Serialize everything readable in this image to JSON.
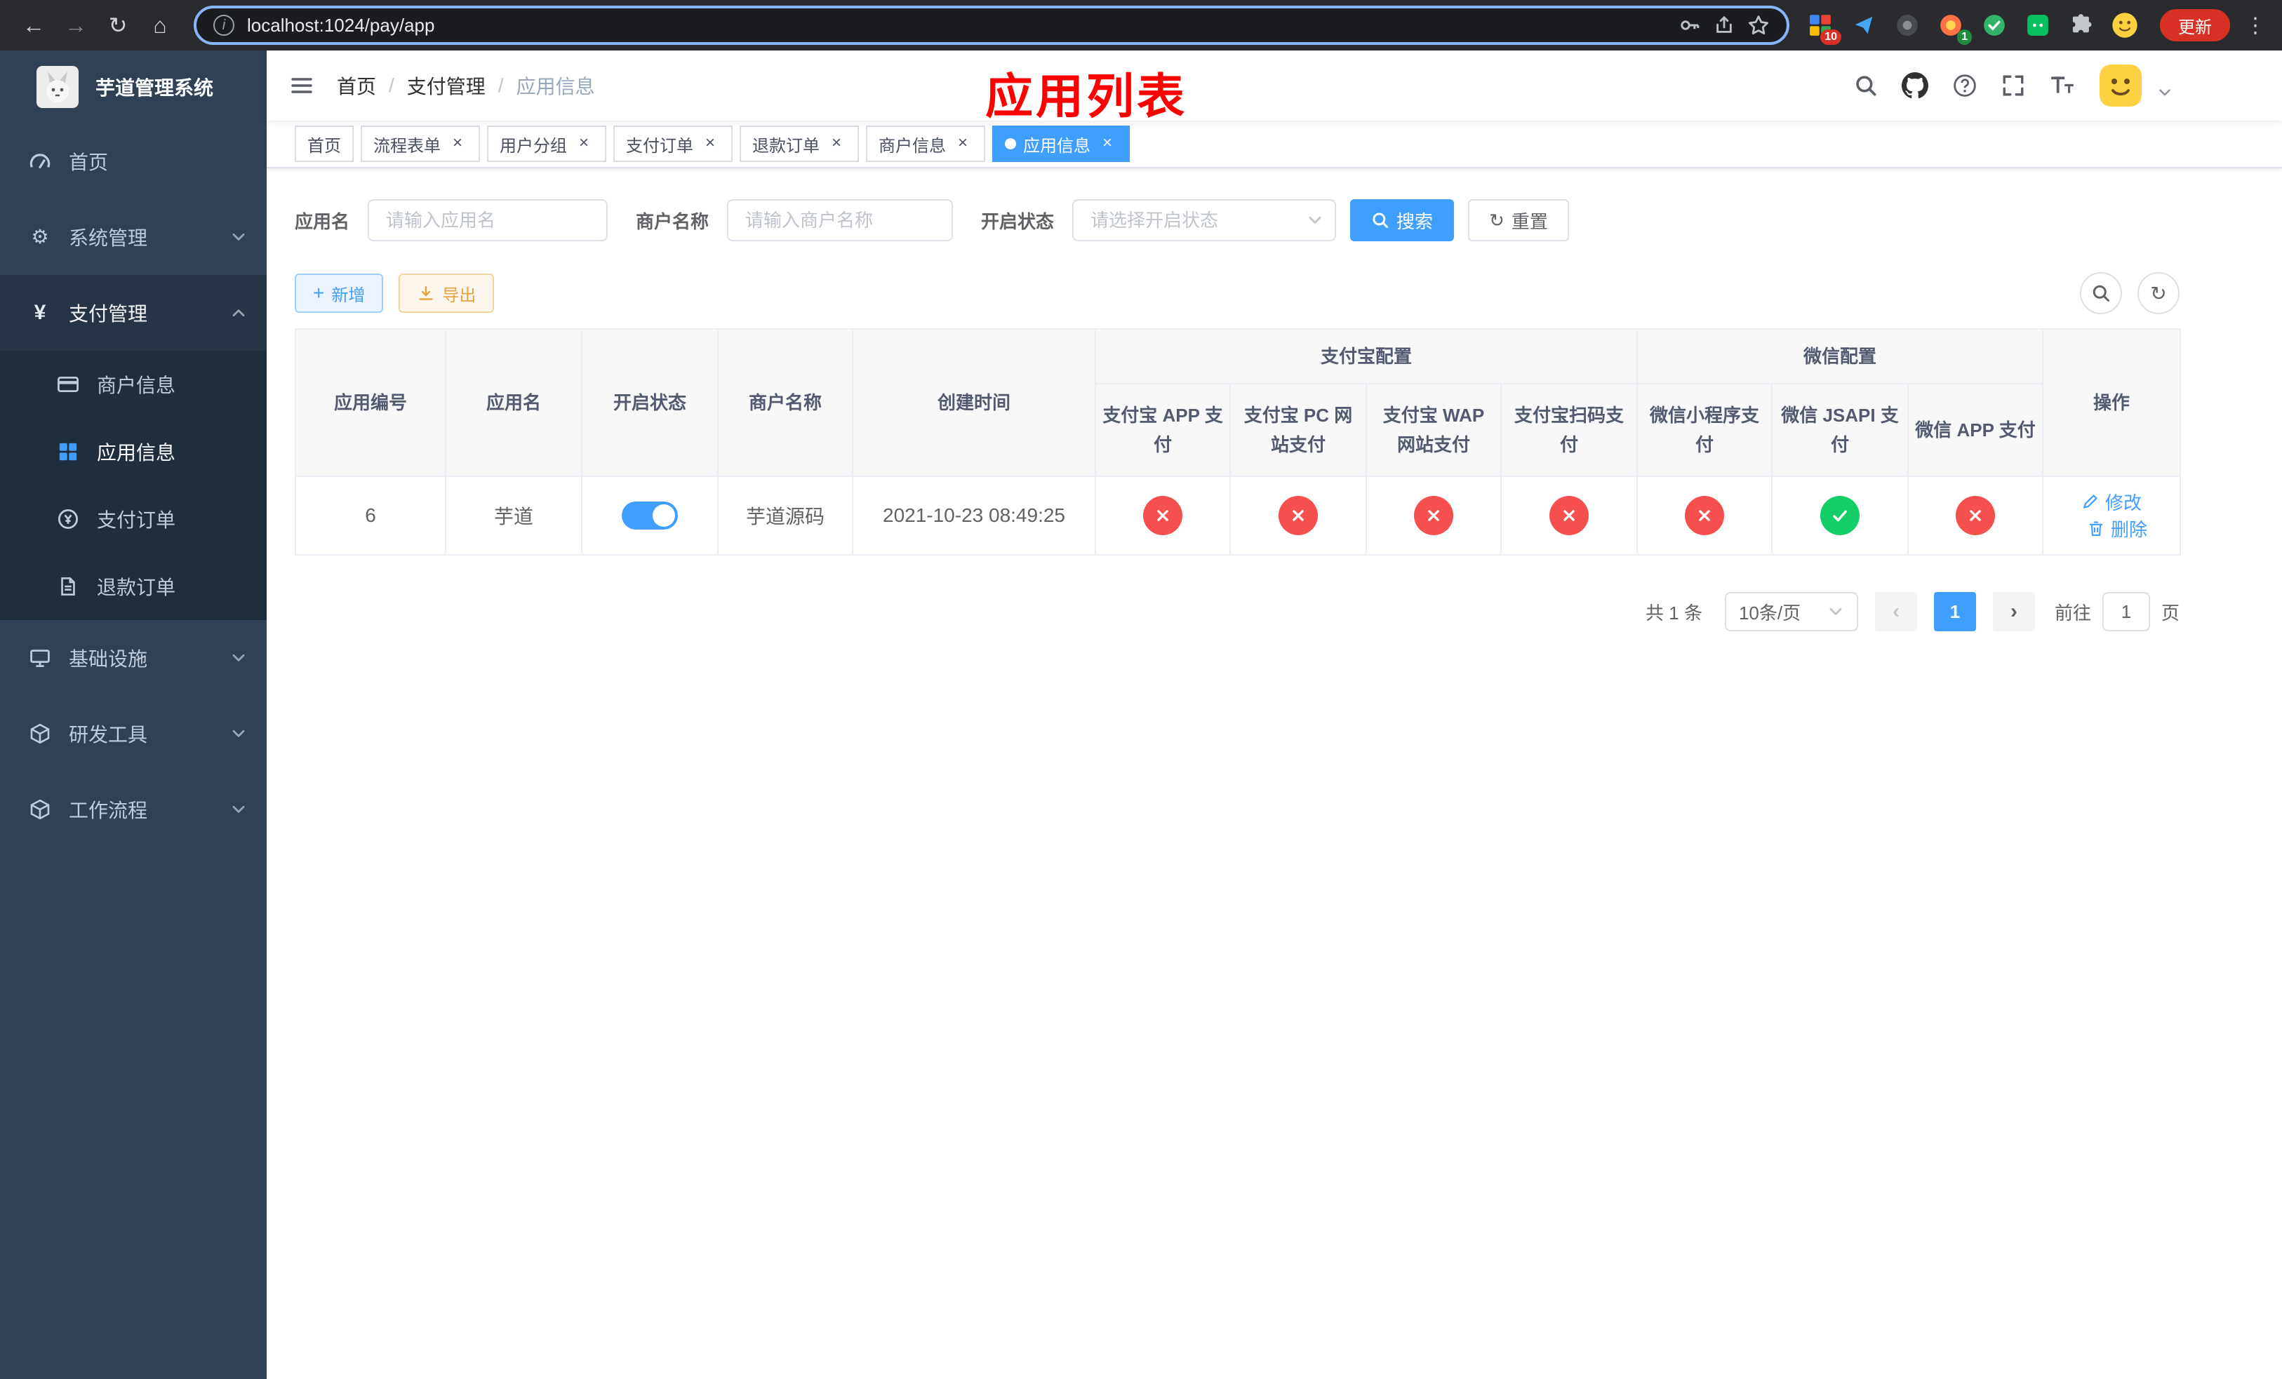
{
  "colors": {
    "accent": "#409eff",
    "success": "#13ce66",
    "danger": "#f5504d",
    "warning": "#e6a23c",
    "sidebar_bg": "#304156",
    "submenu_bg": "#1f2d3d",
    "annotation_red": "#ff0000"
  },
  "icons": {
    "back": "←",
    "forward": "→",
    "reload": "↻",
    "home": "⌂",
    "info": "i",
    "menu_dots": "⋮",
    "close": "×",
    "plus": "+",
    "page_prev": "‹",
    "page_next": "›",
    "yen": "¥",
    "gear": "⚙",
    "breadcrumb_separator": "/"
  },
  "browser": {
    "url": "localhost:1024/pay/app",
    "update_button_label": "更新",
    "extension_badge_red": "10",
    "extension_badge_green": "1"
  },
  "sidebar": {
    "app_title": "芋道管理系统",
    "items": [
      {
        "label": "首页"
      },
      {
        "label": "系统管理"
      },
      {
        "label": "支付管理"
      },
      {
        "label": "基础设施"
      },
      {
        "label": "研发工具"
      },
      {
        "label": "工作流程"
      }
    ],
    "payment_submenu": [
      {
        "label": "商户信息"
      },
      {
        "label": "应用信息"
      },
      {
        "label": "支付订单"
      },
      {
        "label": "退款订单"
      }
    ]
  },
  "navbar": {
    "breadcrumb": [
      {
        "label": "首页"
      },
      {
        "label": "支付管理"
      },
      {
        "label": "应用信息"
      }
    ],
    "annotation": "应用列表"
  },
  "tags_view": {
    "tabs": [
      {
        "label": "首页"
      },
      {
        "label": "流程表单"
      },
      {
        "label": "用户分组"
      },
      {
        "label": "支付订单"
      },
      {
        "label": "退款订单"
      },
      {
        "label": "商户信息"
      },
      {
        "label": "应用信息"
      }
    ]
  },
  "filters": {
    "app_name_label": "应用名",
    "app_name_placeholder": "请输入应用名",
    "merchant_name_label": "商户名称",
    "merchant_name_placeholder": "请输入商户名称",
    "status_label": "开启状态",
    "status_placeholder": "请选择开启状态",
    "search_button": "搜索",
    "reset_button": "重置"
  },
  "toolbar": {
    "add_button": "新增",
    "export_button": "导出"
  },
  "table": {
    "headers": {
      "app_id": "应用编号",
      "app_name": "应用名",
      "status": "开启状态",
      "merchant_name": "商户名称",
      "create_time": "创建时间",
      "alipay_group": "支付宝配置",
      "wechat_group": "微信配置",
      "actions": "操作",
      "channels": [
        "支付宝 APP 支付",
        "支付宝 PC 网站支付",
        "支付宝 WAP 网站支付",
        "支付宝扫码支付",
        "微信小程序支付",
        "微信 JSAPI 支付",
        "微信 APP 支付"
      ]
    },
    "rows": [
      {
        "app_id": "6",
        "app_name": "芋道",
        "status_enabled": true,
        "merchant_name": "芋道源码",
        "create_time": "2021-10-23 08:49:25",
        "channels_enabled": [
          false,
          false,
          false,
          false,
          false,
          true,
          false
        ],
        "edit_label": "修改",
        "delete_label": "删除"
      }
    ]
  },
  "pagination": {
    "total_text": "共 1 条",
    "page_size_text": "10条/页",
    "current_page": "1",
    "goto_prefix": "前往",
    "goto_value": "1",
    "goto_suffix": "页"
  }
}
